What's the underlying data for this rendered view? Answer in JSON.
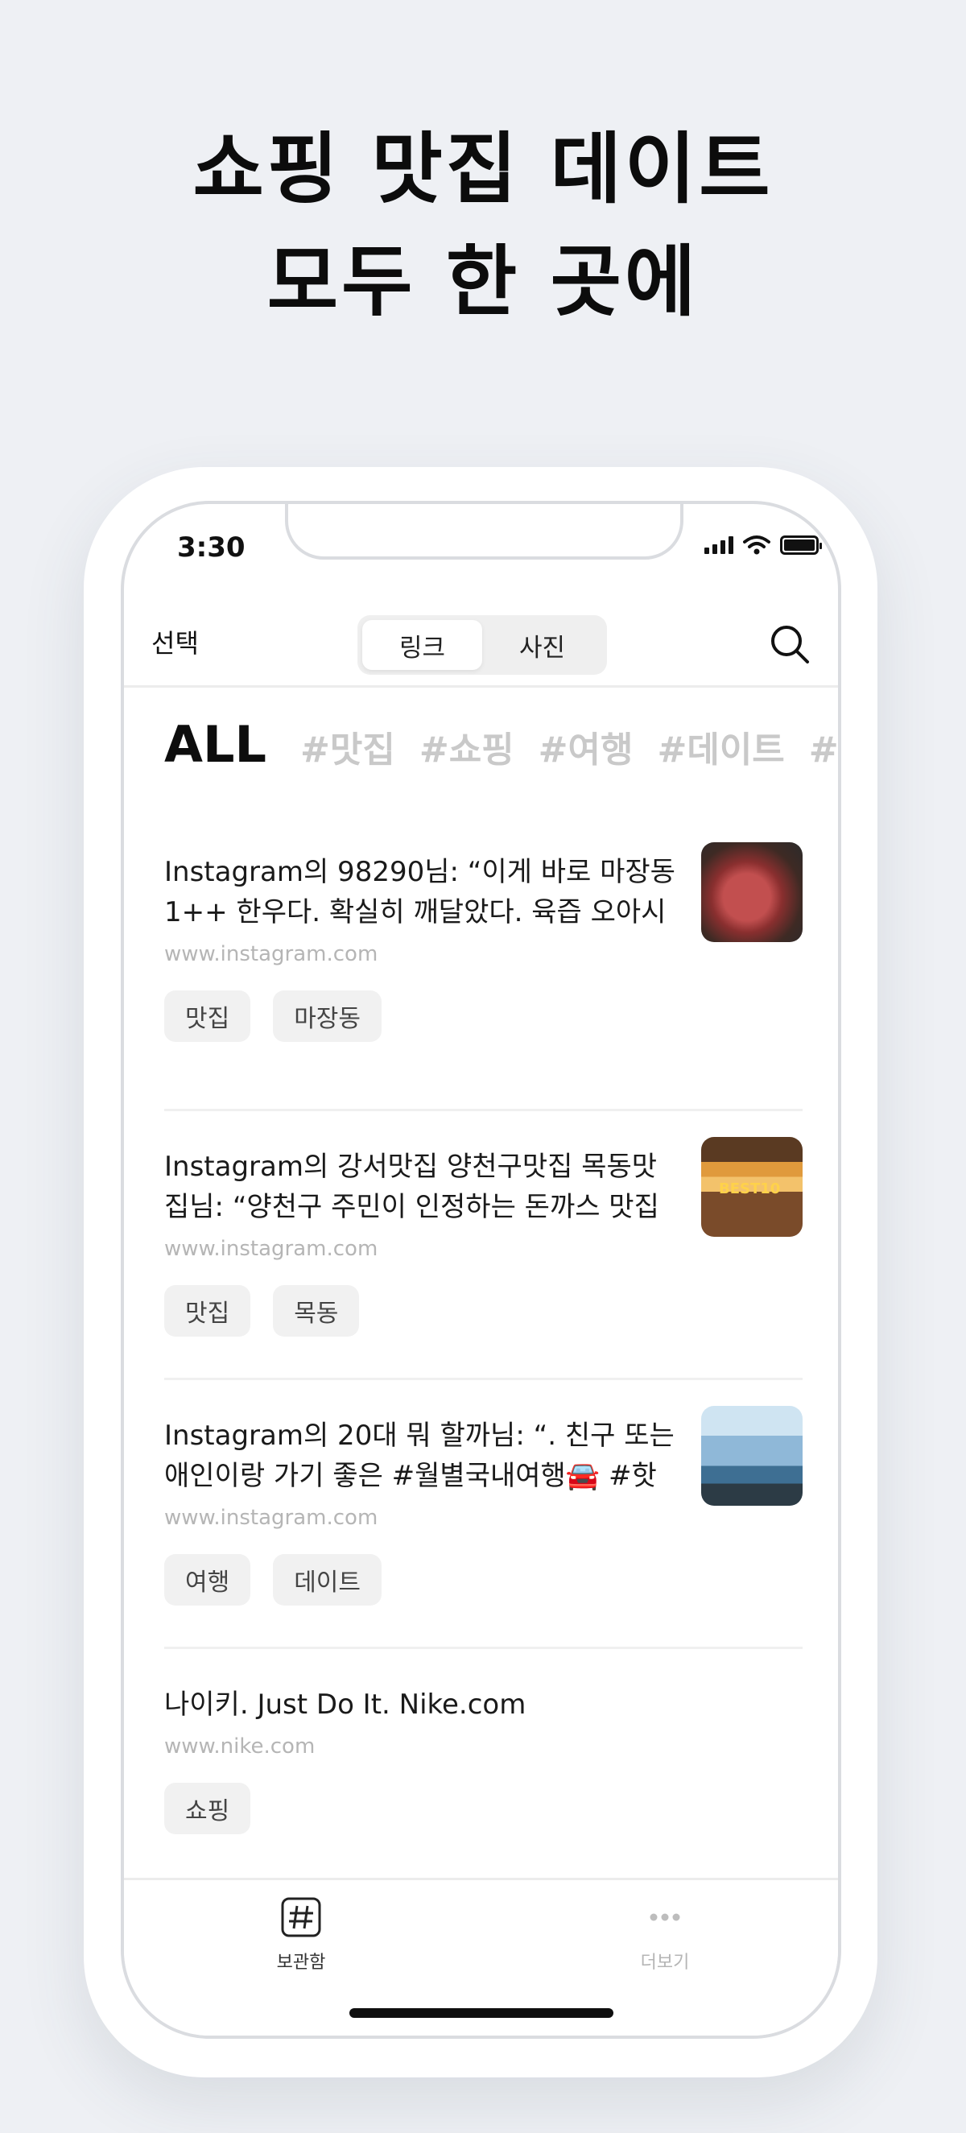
{
  "headline": {
    "line1": "쇼핑 맛집 데이트",
    "line2": "모두 한 곳에"
  },
  "status_bar": {
    "time": "3:30"
  },
  "navbar": {
    "select_label": "선택",
    "segments": [
      "링크",
      "사진"
    ],
    "active_segment": "링크",
    "search_icon": "search-icon"
  },
  "tag_filter": {
    "all": "ALL",
    "tags": [
      "#맛집",
      "#쇼핑",
      "#여행",
      "#데이트",
      "#"
    ]
  },
  "feed": [
    {
      "title": "Instagram의 98290님: “이게 바로 마장동 1++ 한우다. 확실히 깨달았다. 육즙 오아시",
      "domain": "www.instagram.com",
      "tags": [
        "맛집",
        "마장동"
      ],
      "thumbnail": "meat-photo"
    },
    {
      "title": "Instagram의 강서맛집 양천구맛집 목동맛집님: “양천구 주민이 인정하는 돈까스 맛집",
      "domain": "www.instagram.com",
      "tags": [
        "맛집",
        "목동"
      ],
      "thumbnail": "cutlet-photo",
      "thumbnail_text": "BEST10"
    },
    {
      "title": "Instagram의 20대 뭐 할까님: “. 친구 또는 애인이랑 가기 좋은 #월별국내여행🚘 #핫",
      "domain": "www.instagram.com",
      "tags": [
        "여행",
        "데이트"
      ],
      "thumbnail": "beach-photo"
    },
    {
      "title": "나이키. Just Do It. Nike.com",
      "domain": "www.nike.com",
      "tags": [
        "쇼핑"
      ],
      "thumbnail": ""
    }
  ],
  "tabbar": {
    "items": [
      {
        "label": "보관함",
        "icon": "hashtag-icon",
        "active": true
      },
      {
        "label": "더보기",
        "icon": "more-icon",
        "active": false
      }
    ]
  }
}
